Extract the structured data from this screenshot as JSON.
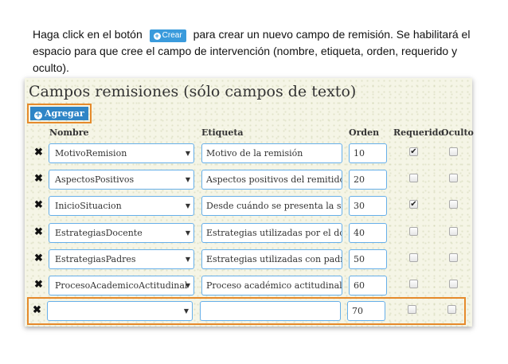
{
  "instruction": {
    "part1": "Haga click en el botón",
    "button_label": "Crear",
    "part2": "para crear un nuevo campo de remisión. Se habilitará el espacio para que cree el campo de intervención (nombre, etiqueta, orden, requerido y oculto)."
  },
  "panel": {
    "title": "Campos remisiones (sólo campos de texto)",
    "add_label": "Agregar",
    "headers": {
      "nombre": "Nombre",
      "etiqueta": "Etiqueta",
      "orden": "Orden",
      "requerido": "Requerido",
      "oculto": "Oculto"
    },
    "delete_glyph": "✖",
    "rows": [
      {
        "nombre": "MotivoRemision",
        "etiqueta": "Motivo de la remisión",
        "orden": "10",
        "requerido": true,
        "oculto": false
      },
      {
        "nombre": "AspectosPositivos",
        "etiqueta": "Aspectos positivos del remitido",
        "orden": "20",
        "requerido": false,
        "oculto": false
      },
      {
        "nombre": "InicioSituacion",
        "etiqueta": "Desde cuándo se presenta la situa",
        "orden": "30",
        "requerido": true,
        "oculto": false
      },
      {
        "nombre": "EstrategiasDocente",
        "etiqueta": "Estrategias utilizadas por el docer",
        "orden": "40",
        "requerido": false,
        "oculto": false
      },
      {
        "nombre": "EstrategiasPadres",
        "etiqueta": "Estrategias utilizadas con padres",
        "orden": "50",
        "requerido": false,
        "oculto": false
      },
      {
        "nombre": "ProcesoAcademicoActitudinal",
        "etiqueta": "Proceso académico actitudinal",
        "orden": "60",
        "requerido": false,
        "oculto": false
      }
    ],
    "new_row": {
      "nombre": "",
      "etiqueta": "",
      "orden": "70",
      "requerido": false,
      "oculto": false
    }
  },
  "colors": {
    "highlight": "#e58a2b",
    "button": "#2f85c6",
    "input_border": "#66afe9"
  },
  "icons": {
    "plus": "plus-circle-icon",
    "caret": "caret-down-icon",
    "delete": "times-icon",
    "check": "check-icon"
  }
}
